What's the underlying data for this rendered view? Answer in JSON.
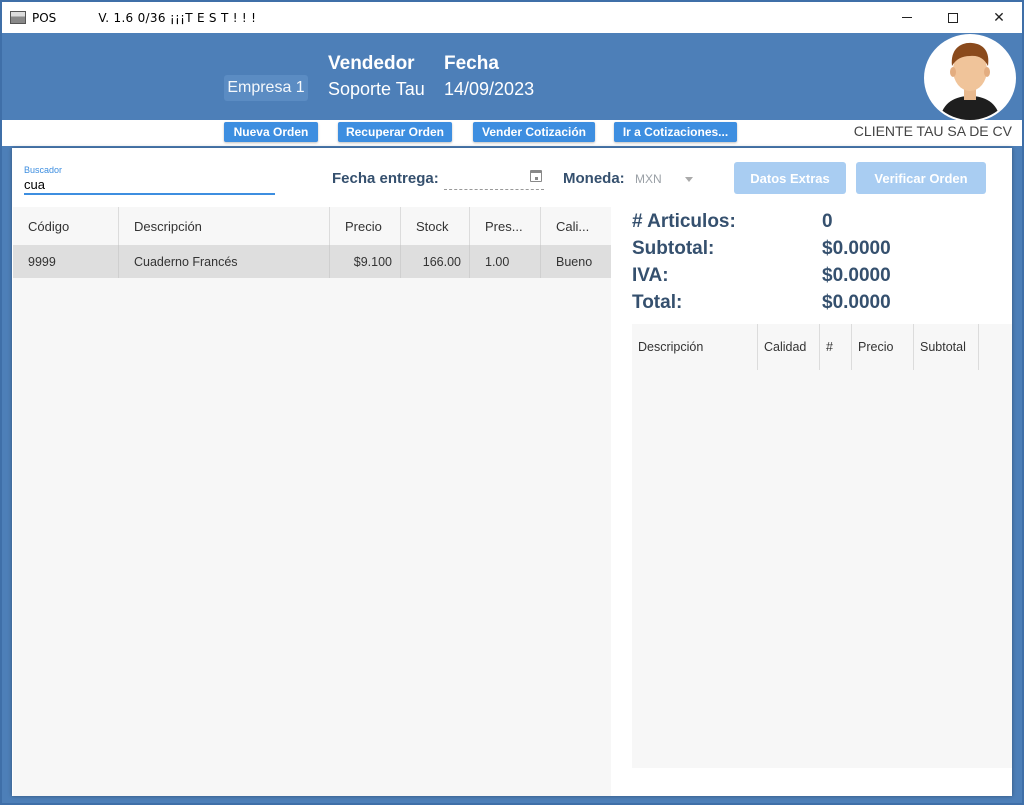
{
  "window": {
    "app_name": "POS",
    "version_text": "V. 1.6  0/36 ¡¡¡T E S T ! ! !",
    "close_glyph": "✕"
  },
  "header": {
    "empresa": "Empresa 1",
    "vendedor_label": "Vendedor",
    "vendedor_value": "Soporte Tau",
    "fecha_label": "Fecha",
    "fecha_value": "14/09/2023"
  },
  "actions": {
    "nueva_orden": "Nueva Orden",
    "recuperar_orden": "Recuperar Orden",
    "vender_cotizacion": "Vender Cotización",
    "ir_cotizaciones": "Ir a Cotizaciones...",
    "cliente": "CLIENTE TAU SA DE CV"
  },
  "search": {
    "label": "Buscador",
    "value": "cua"
  },
  "filters": {
    "fecha_entrega_label": "Fecha entrega:",
    "moneda_label": "Moneda:",
    "moneda_value": "MXN",
    "datos_extras": "Datos Extras",
    "verificar_orden": "Verificar Orden"
  },
  "products": {
    "columns": [
      "Código",
      "Descripción",
      "Precio",
      "Stock",
      "Pres...",
      "Cali..."
    ],
    "rows": [
      [
        "9999",
        "Cuaderno Francés",
        "$9.100",
        "166.00",
        "1.00",
        "Bueno"
      ]
    ]
  },
  "summary": {
    "articulos_label": "# Articulos:",
    "articulos_value": "0",
    "subtotal_label": "Subtotal:",
    "subtotal_value": "$0.0000",
    "iva_label": "IVA:",
    "iva_value": "$0.0000",
    "total_label": "Total:",
    "total_value": "$0.0000"
  },
  "order": {
    "columns": [
      "Descripción",
      "Calidad",
      "#",
      "Precio",
      "Subtotal"
    ]
  },
  "colors": {
    "header_bg": "#4d7fb8",
    "accent": "#3d8ee0",
    "disabled_button": "#a9cdf2",
    "label_text": "#35506e"
  }
}
